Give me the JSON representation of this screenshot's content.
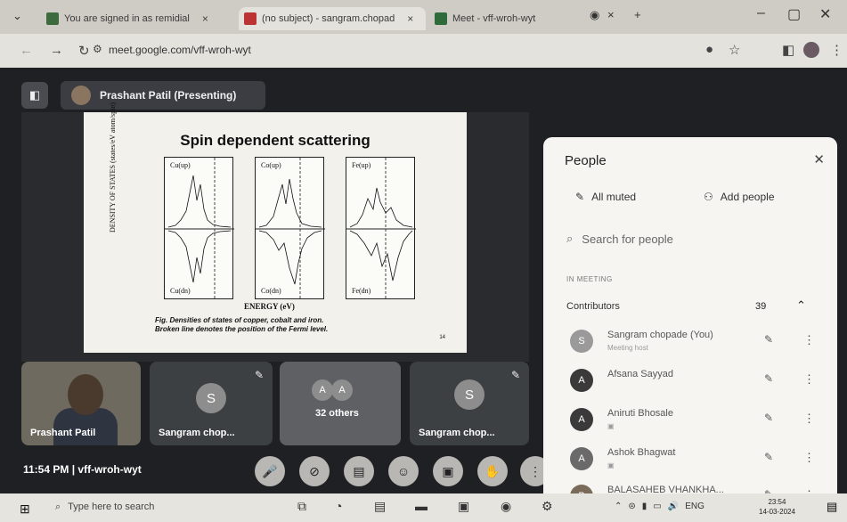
{
  "browser": {
    "tabs": [
      {
        "title": "You are signed in as remidial",
        "close": "×"
      },
      {
        "title": "(no subject) - sangram.chopad",
        "close": "×"
      },
      {
        "title": "Meet - vff-wroh-wyt",
        "close": "×"
      }
    ],
    "tab_dropdown": "⌄",
    "new_tab": "+",
    "record": "◉",
    "window_controls": {
      "minimize": "–",
      "maximize": "▢",
      "close": "✕"
    },
    "url": "meet.google.com/vff-wroh-wyt"
  },
  "meet": {
    "presenter_chip": "Prashant Patil (Presenting)",
    "slide": {
      "title": "Spin dependent scattering",
      "ylabel": "DENSITY OF STATES (states/eV atom/spin)",
      "panels": [
        {
          "top": "Cu(up)",
          "bottom": "Cu(dn)"
        },
        {
          "top": "Co(up)",
          "bottom": "Co(dn)"
        },
        {
          "top": "Fe(up)",
          "bottom": "Fe(dn)"
        }
      ],
      "xlabel": "ENERGY (eV)",
      "caption_line1": "Fig. Densities of states of copper, cobalt and iron.",
      "caption_line2": "Broken line denotes the position of the Fermi level.",
      "page": "14"
    },
    "tiles": [
      {
        "name": "Prashant Patil"
      },
      {
        "name": "Sangram chop...",
        "avatar": "S"
      },
      {
        "name": "32 others",
        "avatar": "A"
      },
      {
        "name": "Sangram chop...",
        "avatar": "S"
      }
    ],
    "time": "11:54 PM",
    "separator": "|",
    "meeting_code": "vff-wroh-wyt",
    "people_badge": "39"
  },
  "people": {
    "title": "People",
    "all_muted": "All muted",
    "add_people": "Add people",
    "search_placeholder": "Search for people",
    "in_meeting": "IN MEETING",
    "contributors": "Contributors",
    "count": "39",
    "participants": [
      {
        "initial": "S",
        "name": "Sangram chopade (You)",
        "sub": "Meeting host",
        "color": "#9a9a9a"
      },
      {
        "initial": "A",
        "name": "Afsana Sayyad",
        "sub": "",
        "color": "#3a3a3a"
      },
      {
        "initial": "A",
        "name": "Aniruti Bhosale",
        "sub": "",
        "color": "#3a3a3a"
      },
      {
        "initial": "A",
        "name": "Ashok Bhagwat",
        "sub": "",
        "color": "#6a6a6a"
      },
      {
        "initial": "B",
        "name": "BALASAHEB VHANKHA...",
        "sub": "",
        "color": "#7a6a58"
      }
    ]
  },
  "taskbar": {
    "search": "Type here to search",
    "lang": "ENG",
    "time": "23:54",
    "date": "14-03-2024"
  }
}
